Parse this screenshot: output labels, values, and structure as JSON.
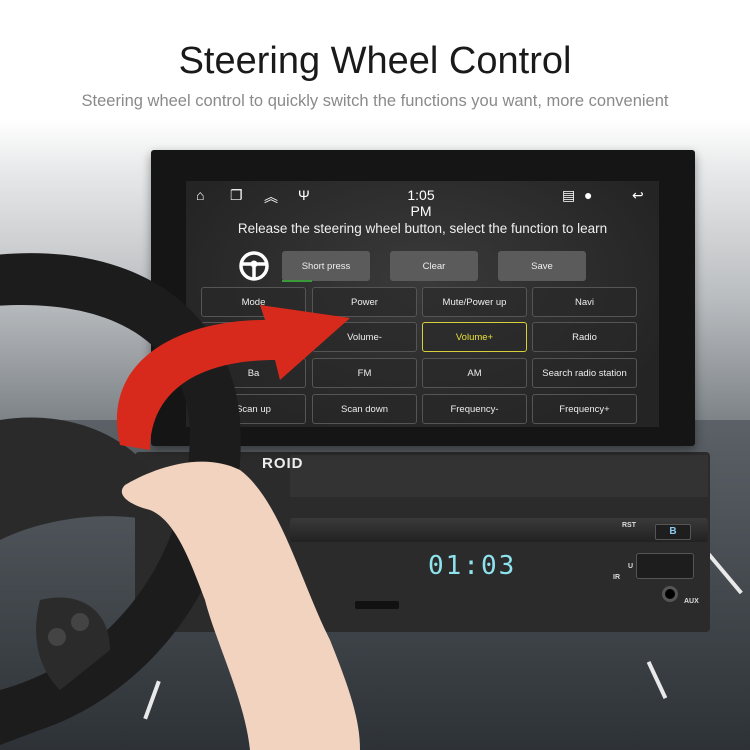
{
  "header": {
    "title": "Steering Wheel Control",
    "subtitle": "Steering wheel control to quickly switch the functions you want, more convenient"
  },
  "statusbar": {
    "time": "1:05 PM",
    "icons": [
      "home-icon",
      "recent-apps-icon",
      "chevrons-up-icon",
      "usb-icon",
      "cast-icon",
      "location-icon",
      "back-icon"
    ]
  },
  "screen": {
    "prompt": "Release the steering wheel button, select the function to learn",
    "controls": [
      {
        "label": "Short press"
      },
      {
        "label": "Clear"
      },
      {
        "label": "Save"
      }
    ],
    "functions": [
      [
        "Mode",
        "Power",
        "Mute/Power up",
        "Navi"
      ],
      [
        "",
        "Volume-",
        "Volume+",
        "Radio"
      ],
      [
        "Ba",
        "FM",
        "AM",
        "Search radio station"
      ],
      [
        "Scan up",
        "Scan down",
        "Frequency-",
        "Frequency+"
      ]
    ],
    "selected": "Volume+",
    "accent": "#d8d03a"
  },
  "unit": {
    "brand": "ROID",
    "lcd": "01:03",
    "rst": "RST",
    "b_button": "B",
    "u_label": "U",
    "ir_label": "IR",
    "aux_label": "AUX"
  }
}
